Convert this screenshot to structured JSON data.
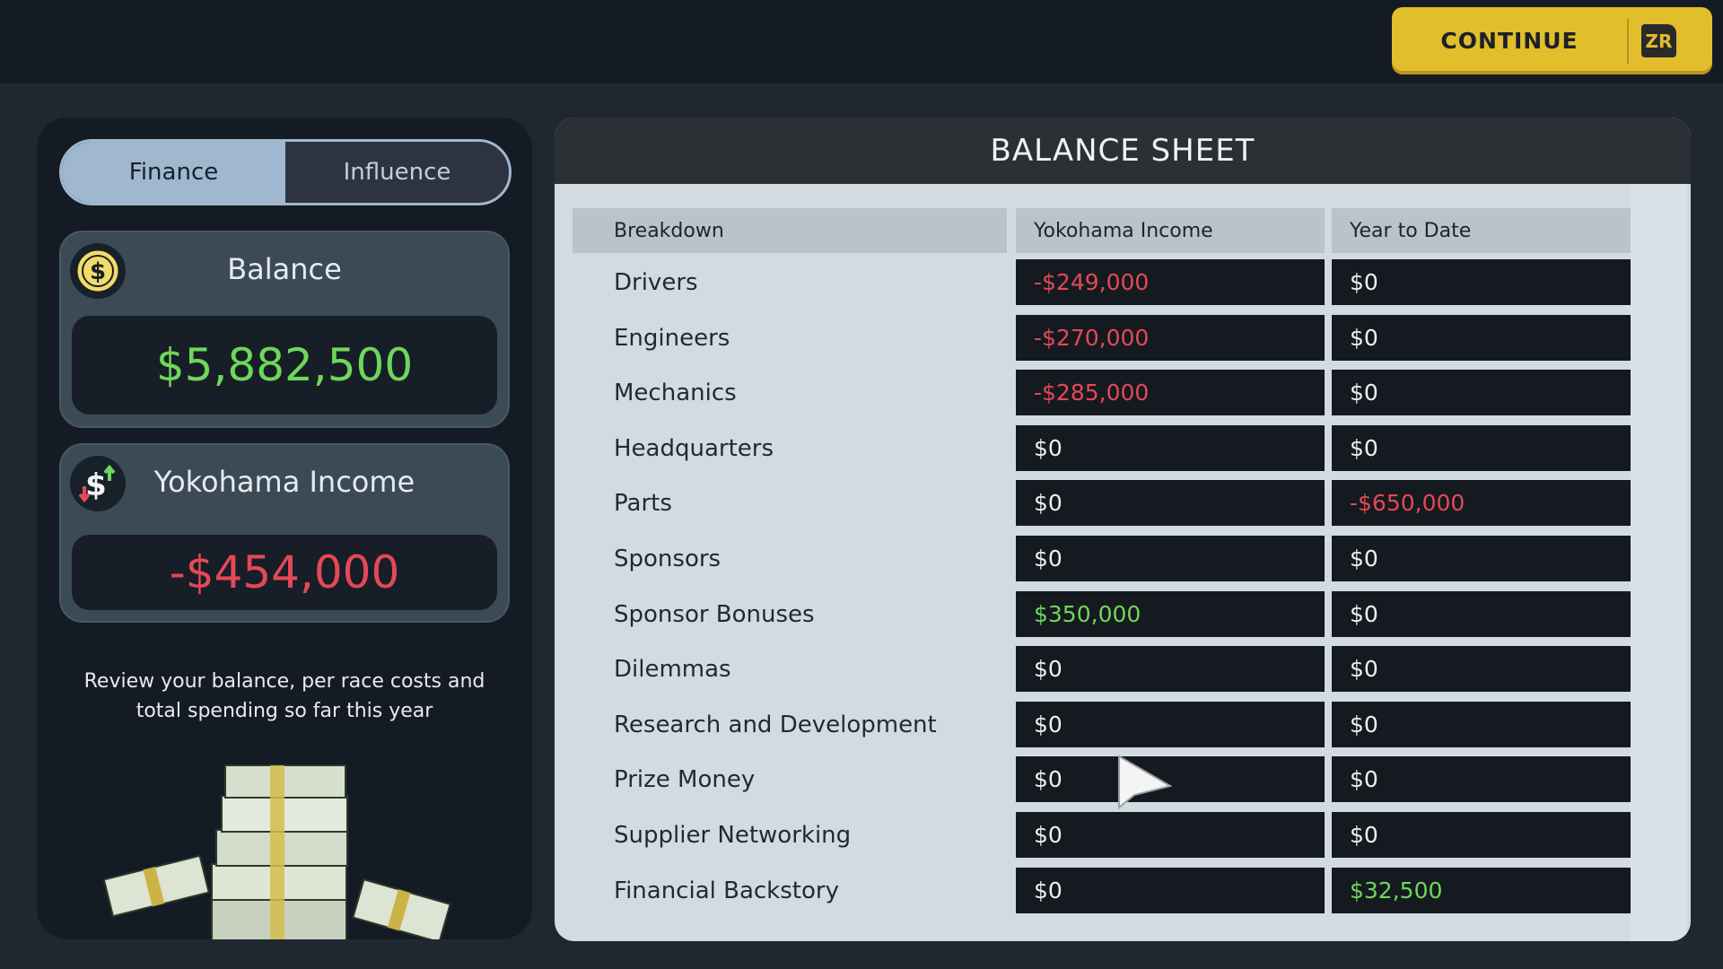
{
  "topbar": {
    "continue_label": "CONTINUE",
    "continue_key": "ZR"
  },
  "tabs": [
    {
      "label": "Finance",
      "active": true
    },
    {
      "label": "Influence",
      "active": false
    }
  ],
  "balance": {
    "title": "Balance",
    "value": "$5,882,500",
    "icon": "dollar-coin-icon",
    "color": "#6fd75a"
  },
  "income": {
    "title": "Yokohama Income",
    "value": "-$454,000",
    "icon": "dollar-transfer-icon",
    "color": "#e54856"
  },
  "hint": "Review your balance, per race costs and total spending so far this year",
  "sheet": {
    "title": "BALANCE SHEET",
    "columns": [
      "Breakdown",
      "Yokohama Income",
      "Year to Date"
    ],
    "rows": [
      {
        "label": "Drivers",
        "income": "-$249,000",
        "income_tone": "neg",
        "ytd": "$0",
        "ytd_tone": "zero"
      },
      {
        "label": "Engineers",
        "income": "-$270,000",
        "income_tone": "neg",
        "ytd": "$0",
        "ytd_tone": "zero"
      },
      {
        "label": "Mechanics",
        "income": "-$285,000",
        "income_tone": "neg",
        "ytd": "$0",
        "ytd_tone": "zero"
      },
      {
        "label": "Headquarters",
        "income": "$0",
        "income_tone": "zero",
        "ytd": "$0",
        "ytd_tone": "zero"
      },
      {
        "label": "Parts",
        "income": "$0",
        "income_tone": "zero",
        "ytd": "-$650,000",
        "ytd_tone": "neg"
      },
      {
        "label": "Sponsors",
        "income": "$0",
        "income_tone": "zero",
        "ytd": "$0",
        "ytd_tone": "zero"
      },
      {
        "label": "Sponsor Bonuses",
        "income": "$350,000",
        "income_tone": "pos",
        "ytd": "$0",
        "ytd_tone": "zero"
      },
      {
        "label": "Dilemmas",
        "income": "$0",
        "income_tone": "zero",
        "ytd": "$0",
        "ytd_tone": "zero"
      },
      {
        "label": "Research and Development",
        "income": "$0",
        "income_tone": "zero",
        "ytd": "$0",
        "ytd_tone": "zero"
      },
      {
        "label": "Prize Money",
        "income": "$0",
        "income_tone": "zero",
        "ytd": "$0",
        "ytd_tone": "zero"
      },
      {
        "label": "Supplier Networking",
        "income": "$0",
        "income_tone": "zero",
        "ytd": "$0",
        "ytd_tone": "zero"
      },
      {
        "label": "Financial Backstory",
        "income": "$0",
        "income_tone": "zero",
        "ytd": "$32,500",
        "ytd_tone": "pos"
      }
    ]
  },
  "tone_colors": {
    "neg": "#e54856",
    "pos": "#6fd75a",
    "zero": "#eef1f3"
  }
}
